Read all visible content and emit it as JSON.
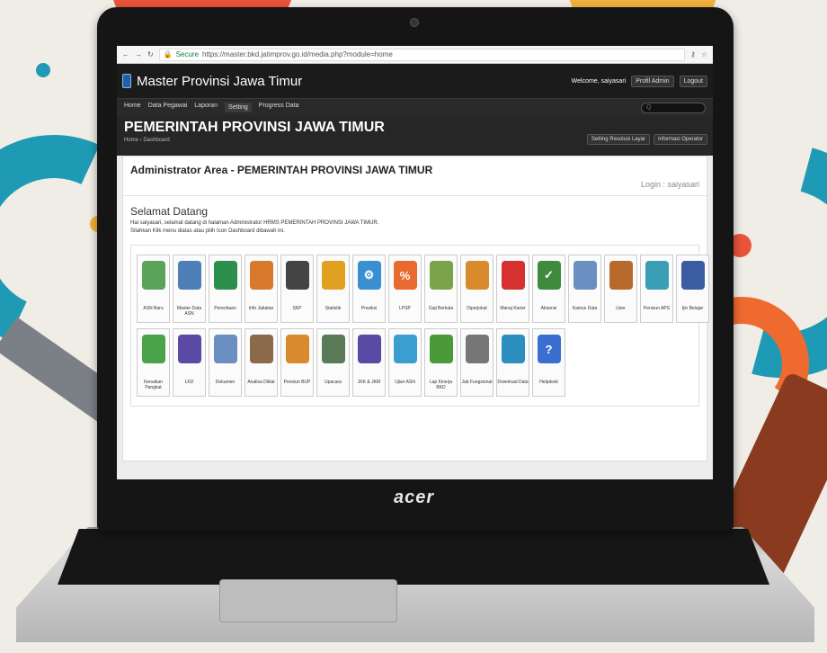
{
  "browser": {
    "secure_label": "Secure",
    "url": "https://master.bkd.jatimprov.go.id/media.php?module=home"
  },
  "app": {
    "title": "Master Provinsi Jawa Timur",
    "welcome": "Welcome, saiyasari",
    "btn_profile": "Profil Admin",
    "btn_logout": "Logout"
  },
  "nav": {
    "items": [
      "Home",
      "Data Pegawai",
      "Laporan",
      "Setting",
      "Progress Data"
    ],
    "search_placeholder": "Q"
  },
  "hero": {
    "title": "PEMERINTAH PROVINSI JAWA TIMUR",
    "breadcrumb": "Home › Dashboard",
    "btn1": "Setting Resolusi Layar",
    "btn2": "Informasi Operator"
  },
  "panel": {
    "title": "Administrator Area - PEMERINTAH PROVINSI JAWA TIMUR",
    "login": "Login : saiyasari",
    "welcome_title": "Selamat Datang",
    "welcome_line1": "Hai saiyasari, selamat datang di halaman Administrator HRMS PEMERINTAH PROVINSI JAWA TIMUR.",
    "welcome_line2": "Silahkan Klik menu diatas atau pilih Icon Dashboard dibawah ini."
  },
  "tiles": [
    {
      "label": "ASN Baru",
      "icon": "user-add-icon",
      "color": "#5aa35a"
    },
    {
      "label": "Master Data ASN",
      "icon": "database-icon",
      "color": "#4f7fb8"
    },
    {
      "label": "Penerbaan",
      "icon": "book-icon",
      "color": "#2d8f4e"
    },
    {
      "label": "Info Jabatan",
      "icon": "folders-icon",
      "color": "#d9792c"
    },
    {
      "label": "SKP",
      "icon": "target-icon",
      "color": "#444444"
    },
    {
      "label": "Statistik",
      "icon": "pie-chart-icon",
      "color": "#e0a020"
    },
    {
      "label": "Presiksi",
      "icon": "gear-icon",
      "color": "#3a8fd0"
    },
    {
      "label": "LPSP",
      "icon": "percent-icon",
      "color": "#e86a2e"
    },
    {
      "label": "Gaji Berkala",
      "icon": "money-icon",
      "color": "#7aa34a"
    },
    {
      "label": "Diperjokat",
      "icon": "person-icon",
      "color": "#d98a2c"
    },
    {
      "label": "Manaj Karier",
      "icon": "runner-icon",
      "color": "#d63030"
    },
    {
      "label": "Absensi",
      "icon": "checkmark-icon",
      "color": "#3f8a3f"
    },
    {
      "label": "Kamus Data",
      "icon": "document-icon",
      "color": "#6a8fc0"
    },
    {
      "label": "User",
      "icon": "users-icon",
      "color": "#b86a2c"
    },
    {
      "label": "Pensiun APS",
      "icon": "umbrella-icon",
      "color": "#3a9fb5"
    },
    {
      "label": "Ijin Belajar",
      "icon": "graduation-icon",
      "color": "#3b5ba3"
    },
    {
      "label": "Kenaikan Pangkat",
      "icon": "stairs-icon",
      "color": "#4aa34a"
    },
    {
      "label": "LKD",
      "icon": "seal-icon",
      "color": "#5a4aa3"
    },
    {
      "label": "Dokumen",
      "icon": "document-stack-icon",
      "color": "#6a8fc0"
    },
    {
      "label": "Analisa Diklat",
      "icon": "presentation-icon",
      "color": "#8a6a4a"
    },
    {
      "label": "Pensiun BUP",
      "icon": "handshake-icon",
      "color": "#d98a2c"
    },
    {
      "label": "Upacara",
      "icon": "terminal-icon",
      "color": "#5a7a5a"
    },
    {
      "label": "JKK & JKM",
      "icon": "seal-icon",
      "color": "#5a4aa3"
    },
    {
      "label": "Ujian ASN",
      "icon": "group-icon",
      "color": "#3a9fd0"
    },
    {
      "label": "Lap Kinerja BKD",
      "icon": "puzzle-icon",
      "color": "#4a9a3a"
    },
    {
      "label": "Jab Fungsional",
      "icon": "bar-chart-icon",
      "color": "#777777"
    },
    {
      "label": "Download Data",
      "icon": "globe-icon",
      "color": "#2d8fc0"
    },
    {
      "label": "Helpdesk",
      "icon": "help-icon",
      "color": "#3a6fd0"
    }
  ],
  "laptop": {
    "brand": "acer"
  }
}
